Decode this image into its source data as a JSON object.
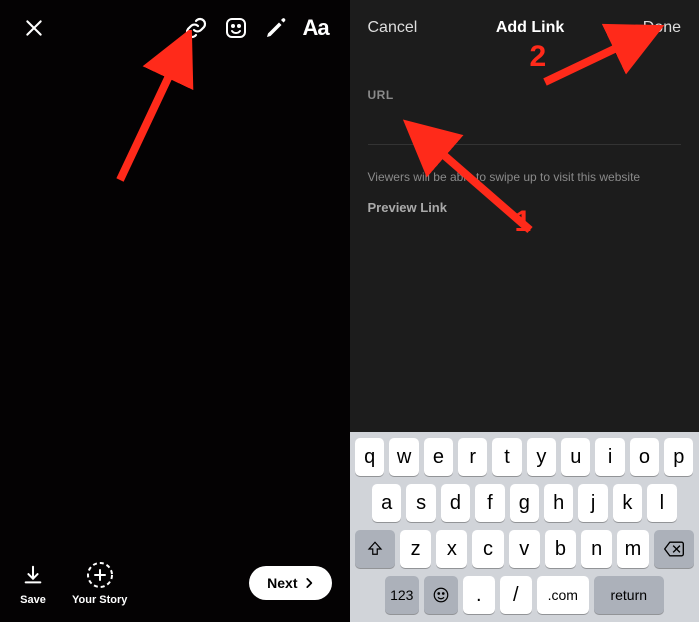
{
  "left": {
    "toolbar": {
      "close": "close",
      "link": "link",
      "sticker": "sticker",
      "draw": "draw",
      "text_tool": "Aa"
    },
    "bottom": {
      "save_label": "Save",
      "your_story_label": "Your Story",
      "next_label": "Next"
    }
  },
  "right": {
    "header": {
      "cancel": "Cancel",
      "title": "Add Link",
      "done": "Done"
    },
    "url_label": "URL",
    "url_value": "",
    "info_text": "Viewers will be able to swipe up to visit this website",
    "preview_link": "Preview Link"
  },
  "keyboard": {
    "row1": [
      "q",
      "w",
      "e",
      "r",
      "t",
      "y",
      "u",
      "i",
      "o",
      "p"
    ],
    "row2": [
      "a",
      "s",
      "d",
      "f",
      "g",
      "h",
      "j",
      "k",
      "l"
    ],
    "row3": [
      "z",
      "x",
      "c",
      "v",
      "b",
      "n",
      "m"
    ],
    "k123": "123",
    "dot": ".",
    "slash": "/",
    "com": ".com",
    "ret": "return"
  },
  "annotations": {
    "num1": "1",
    "num2": "2"
  }
}
